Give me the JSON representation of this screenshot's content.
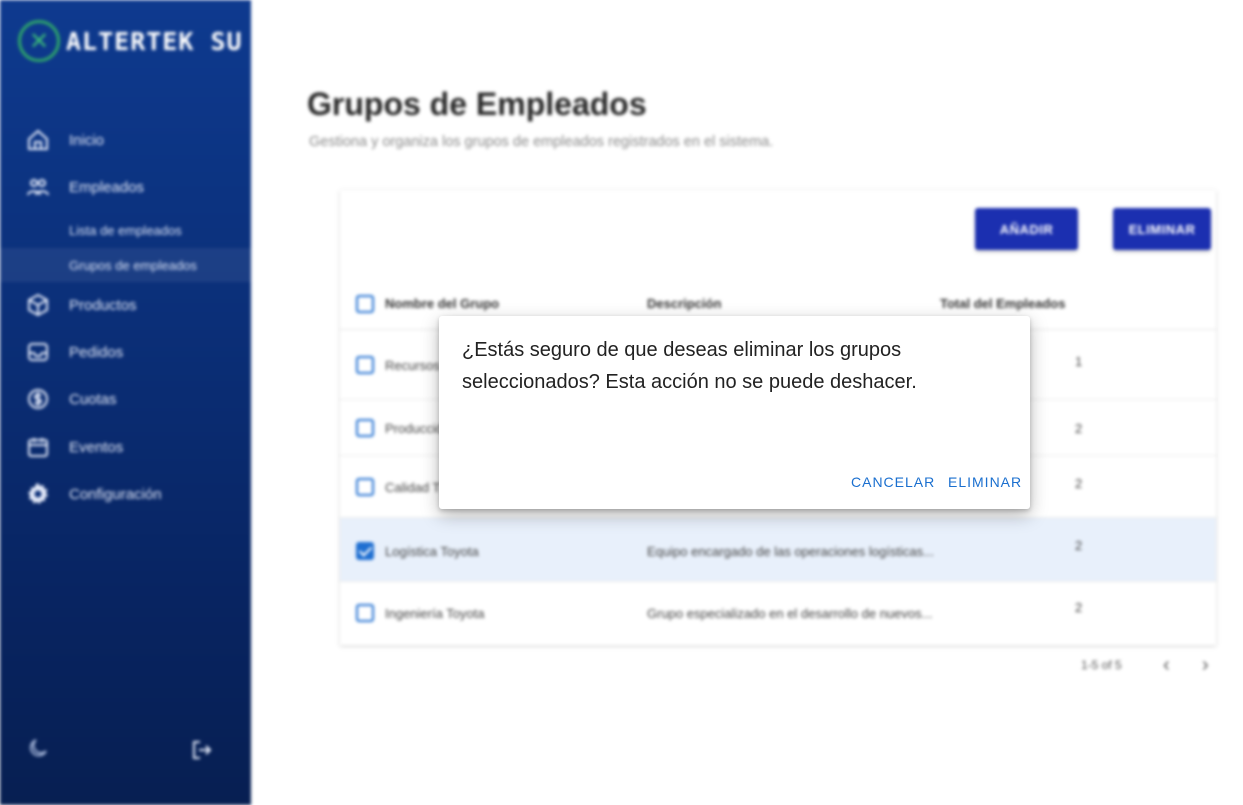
{
  "brand": {
    "logo_text": "ALTERTEK SU",
    "logo_mark": "✕"
  },
  "sidebar": {
    "items": [
      {
        "label": "Inicio",
        "icon": "home-icon"
      },
      {
        "label": "Empleados",
        "icon": "employees-icon"
      },
      {
        "label": "Productos",
        "icon": "box-icon"
      },
      {
        "label": "Pedidos",
        "icon": "inbox-icon"
      },
      {
        "label": "Cuotas",
        "icon": "coin-icon"
      },
      {
        "label": "Eventos",
        "icon": "calendar-icon"
      },
      {
        "label": "Configuración",
        "icon": "gear-icon"
      }
    ],
    "subitems": [
      {
        "label": "Lista de empleados"
      },
      {
        "label": "Grupos de empleados",
        "active": true
      }
    ],
    "bottom": {
      "theme_icon": "moon-icon",
      "logout_icon": "logout-icon"
    }
  },
  "page": {
    "title": "Grupos de Empleados",
    "subtitle": "Gestiona y organiza los grupos de empleados registrados en el sistema."
  },
  "toolbar": {
    "add_label": "AÑADIR",
    "delete_label": "ELIMINAR"
  },
  "table": {
    "columns": [
      "Nombre del Grupo",
      "Descripción",
      "Total del Empleados"
    ],
    "rows": [
      {
        "name": "Recursos",
        "description": "",
        "total": "1",
        "selected": false
      },
      {
        "name": "Producción",
        "description": "",
        "total": "2",
        "selected": false
      },
      {
        "name": "Calidad T",
        "description": "",
        "total": "2",
        "selected": false
      },
      {
        "name": "Logística Toyota",
        "description": "Equipo encargado de las operaciones logísticas...",
        "total": "2",
        "selected": true
      },
      {
        "name": "Ingeniería Toyota",
        "description": "Grupo especializado en el desarrollo de nuevos...",
        "total": "2",
        "selected": false
      }
    ],
    "pagination": {
      "range": "1-5 of 5",
      "prev": "‹",
      "next": "›"
    }
  },
  "dialog": {
    "message": "¿Estás seguro de que deseas eliminar los grupos seleccionados? Esta acción no se puede deshacer.",
    "cancel_label": "CANCELAR",
    "confirm_label": "ELIMINAR"
  },
  "colors": {
    "primary": "#1b2fb0",
    "link": "#1a6fcf",
    "sidebar": "#0b2f78",
    "selected_row": "#e8f0fb"
  }
}
